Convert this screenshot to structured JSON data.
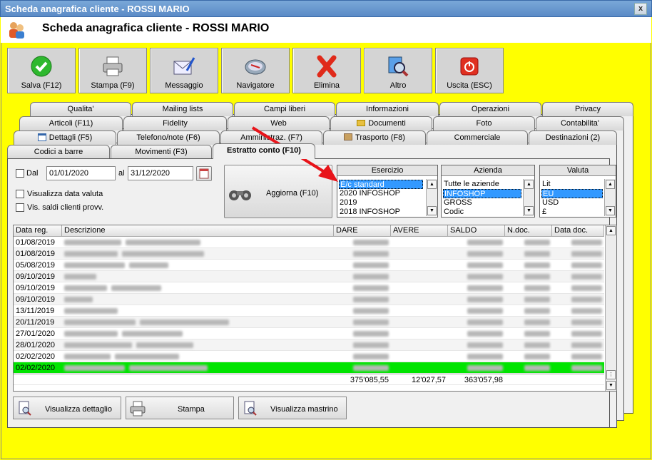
{
  "window": {
    "title": "Scheda anagrafica cliente - ROSSI MARIO",
    "close_glyph": "x"
  },
  "header": {
    "title": "Scheda anagrafica cliente - ROSSI MARIO",
    "icon": "people-icon"
  },
  "toolbar": [
    {
      "label": "Salva (F12)",
      "icon": "check-icon"
    },
    {
      "label": "Stampa (F9)",
      "icon": "printer-icon"
    },
    {
      "label": "Messaggio",
      "icon": "envelope-icon"
    },
    {
      "label": "Navigatore",
      "icon": "compass-icon"
    },
    {
      "label": "Elimina",
      "icon": "red-x-icon"
    },
    {
      "label": "Altro",
      "icon": "magnifier-icon"
    },
    {
      "label": "Uscita (ESC)",
      "icon": "exit-icon"
    }
  ],
  "tabs": {
    "row1": [
      "Qualita'",
      "Mailing lists",
      "Campi liberi",
      "Informazioni",
      "Operazioni",
      "Privacy"
    ],
    "row2": [
      "Articoli (F11)",
      "Fidelity",
      "Web",
      "Documenti",
      "Foto",
      "Contabilita'"
    ],
    "row3": [
      "Dettagli (F5)",
      "Telefono/note (F6)",
      "Amministraz. (F7)",
      "Trasporto (F8)",
      "Commerciale",
      "Destinazioni (2)"
    ],
    "row4": [
      "Codici a barre",
      "Movimenti (F3)",
      "Estratto conto (F10)"
    ]
  },
  "filters": {
    "dal_label": "Dal",
    "dal_value": "01/01/2020",
    "al_label": "al",
    "al_value": "31/12/2020",
    "vis_data_valuta": "Visualizza data valuta",
    "vis_saldi": "Vis. saldi clienti provv.",
    "refresh_label": "Aggiorna (F10)"
  },
  "esercizio": {
    "header": "Esercizio",
    "items": [
      "E/c standard",
      "2020 INFOSHOP",
      "2019",
      "2018 INFOSHOP"
    ],
    "selected": 0
  },
  "azienda": {
    "header": "Azienda",
    "items": [
      "Tutte le aziende",
      "INFOSHOP",
      "GROSS",
      "Codic"
    ],
    "selected": 1
  },
  "valuta": {
    "header": "Valuta",
    "items": [
      "Lit",
      "EU",
      "USD",
      "£"
    ],
    "selected": 1
  },
  "grid": {
    "columns": [
      "Data reg.",
      "Descrizione",
      "DARE",
      "AVERE",
      "SALDO",
      "N.doc.",
      "Data doc."
    ],
    "rows": [
      "01/08/2019",
      "01/08/2019",
      "05/08/2019",
      "09/10/2019",
      "09/10/2019",
      "09/10/2019",
      "13/11/2019",
      "20/11/2019",
      "27/01/2020",
      "28/01/2020",
      "02/02/2020",
      "02/02/2020"
    ],
    "totals": {
      "dare": "375'085,55",
      "avere": "12'027,57",
      "saldo": "363'057,98"
    }
  },
  "bottom_buttons": [
    "Visualizza dettaglio",
    "Stampa",
    "Visualizza mastrino"
  ],
  "colors": {
    "background": "#ffff00",
    "highlight_row": "#00e400",
    "selection": "#3399ff",
    "arrow": "#e8141a"
  }
}
